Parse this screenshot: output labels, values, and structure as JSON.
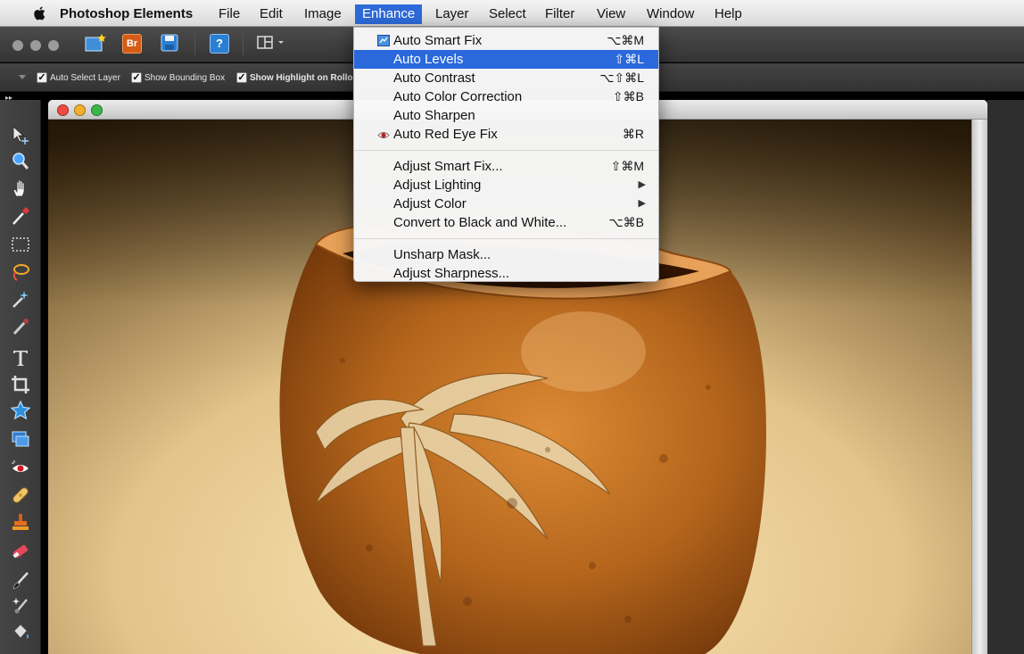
{
  "menubar": {
    "app_name": "Photoshop Elements",
    "items": [
      "File",
      "Edit",
      "Image",
      "Enhance",
      "Layer",
      "Select",
      "Filter",
      "View",
      "Window",
      "Help"
    ],
    "active_item": "Enhance"
  },
  "toolbar": {
    "bridge_label": "Br",
    "help_label": "?"
  },
  "options_bar": {
    "auto_select_layer": "Auto Select Layer",
    "show_bounding_box": "Show Bounding Box",
    "show_highlight": "Show Highlight on Rollo",
    "checked": true
  },
  "tools_panel": {
    "tools": [
      "move-tool",
      "zoom-tool",
      "hand-tool",
      "eyedropper-tool",
      "marquee-tool",
      "lasso-tool",
      "magic-wand-tool",
      "quick-selection-tool",
      "type-tool",
      "crop-tool",
      "cookie-cutter-tool",
      "straighten-tool",
      "red-eye-tool",
      "spot-healing-tool",
      "clone-stamp-tool",
      "eraser-tool",
      "brush-tool",
      "smart-brush-tool",
      "paint-bucket-tool"
    ]
  },
  "enhance_menu": {
    "group1": [
      {
        "label": "Auto Smart Fix",
        "shortcut": "⌥⌘M",
        "icon": "auto-smart-fix-icon"
      },
      {
        "label": "Auto Levels",
        "shortcut": "⇧⌘L",
        "highlighted": true
      },
      {
        "label": "Auto Contrast",
        "shortcut": "⌥⇧⌘L"
      },
      {
        "label": "Auto Color Correction",
        "shortcut": "⇧⌘B"
      },
      {
        "label": "Auto Sharpen",
        "shortcut": ""
      },
      {
        "label": "Auto Red Eye Fix",
        "shortcut": "⌘R",
        "icon": "red-eye-icon"
      }
    ],
    "group2": [
      {
        "label": "Adjust Smart Fix...",
        "shortcut": "⇧⌘M"
      },
      {
        "label": "Adjust Lighting",
        "shortcut": "",
        "submenu": true
      },
      {
        "label": "Adjust Color",
        "shortcut": "",
        "submenu": true
      },
      {
        "label": "Convert to Black and White...",
        "shortcut": "⌥⌘B"
      }
    ],
    "group3": [
      {
        "label": "Unsharp Mask...",
        "shortcut": ""
      },
      {
        "label": "Adjust Sharpness...",
        "shortcut": ""
      }
    ]
  },
  "colors": {
    "menu_highlight": "#2a68dc",
    "app_chrome": "#3c3c3c",
    "bowl_wood": "#b8661a",
    "background_warm": "#e7c98d"
  }
}
